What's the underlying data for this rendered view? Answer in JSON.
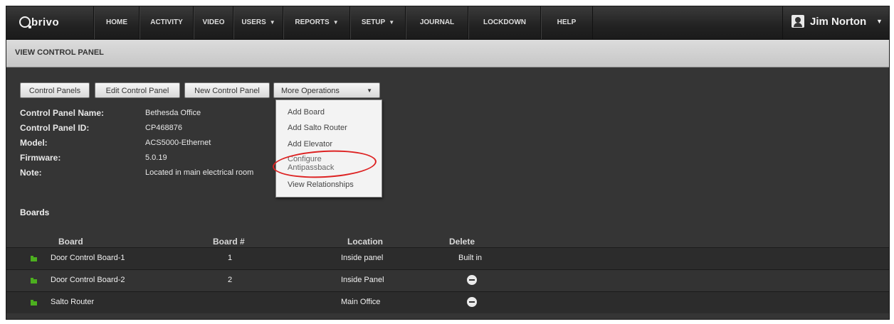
{
  "nav": {
    "logo": "brivo",
    "items": [
      {
        "label": "HOME",
        "caret": ""
      },
      {
        "label": "ACTIVITY",
        "caret": ""
      },
      {
        "label": "VIDEO",
        "caret": ""
      },
      {
        "label": "USERS",
        "caret": "▼"
      },
      {
        "label": "REPORTS",
        "caret": "▼"
      },
      {
        "label": "SETUP",
        "caret": "▼"
      },
      {
        "label": "JOURNAL",
        "caret": ""
      },
      {
        "label": "LOCKDOWN",
        "caret": ""
      },
      {
        "label": "HELP",
        "caret": ""
      }
    ],
    "user": {
      "name": "Jim Norton",
      "caret": "▼"
    }
  },
  "header": {
    "title": "VIEW CONTROL PANEL"
  },
  "toolbar": {
    "control_panels": "Control Panels",
    "edit_control_panel": "Edit Control Panel",
    "new_control_panel": "New Control Panel",
    "more_operations": "More Operations"
  },
  "details": [
    {
      "label": "Control Panel Name:",
      "value": "Bethesda Office"
    },
    {
      "label": "Control Panel ID:",
      "value": "CP468876"
    },
    {
      "label": "Model:",
      "value": "ACS5000-Ethernet"
    },
    {
      "label": "Firmware:",
      "value": "5.0.19"
    },
    {
      "label": "Note:",
      "value": "Located in main electrical room"
    }
  ],
  "menu": {
    "items": [
      "Add Board",
      "Add Salto Router",
      "Add Elevator",
      "Configure",
      "Antipassback",
      "View Relationships"
    ],
    "highlight_color": "#dd2222"
  },
  "boards": {
    "title": "Boards",
    "columns": [
      "Board",
      "Board #",
      "Location",
      "Delete"
    ],
    "rows": [
      {
        "board": "Door Control Board-1",
        "number": "1",
        "location": "Inside panel",
        "delete": "Built in"
      },
      {
        "board": "Door Control Board-2",
        "number": "2",
        "location": "Inside Panel",
        "delete": ""
      },
      {
        "board": "Salto Router",
        "number": "",
        "location": "Main Office",
        "delete": ""
      }
    ],
    "icon_color": "#4caf1f"
  }
}
